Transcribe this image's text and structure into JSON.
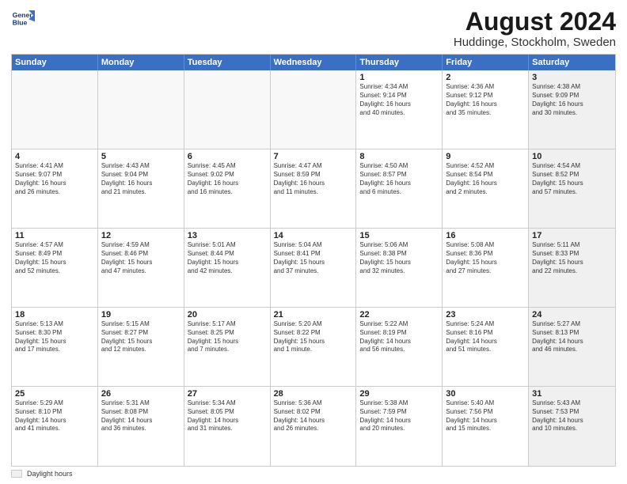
{
  "logo": {
    "line1": "General",
    "line2": "Blue"
  },
  "title": "August 2024",
  "subtitle": "Huddinge, Stockholm, Sweden",
  "weekdays": [
    "Sunday",
    "Monday",
    "Tuesday",
    "Wednesday",
    "Thursday",
    "Friday",
    "Saturday"
  ],
  "weeks": [
    [
      {
        "day": "",
        "info": "",
        "empty": true
      },
      {
        "day": "",
        "info": "",
        "empty": true
      },
      {
        "day": "",
        "info": "",
        "empty": true
      },
      {
        "day": "",
        "info": "",
        "empty": true
      },
      {
        "day": "1",
        "info": "Sunrise: 4:34 AM\nSunset: 9:14 PM\nDaylight: 16 hours\nand 40 minutes."
      },
      {
        "day": "2",
        "info": "Sunrise: 4:36 AM\nSunset: 9:12 PM\nDaylight: 16 hours\nand 35 minutes."
      },
      {
        "day": "3",
        "info": "Sunrise: 4:38 AM\nSunset: 9:09 PM\nDaylight: 16 hours\nand 30 minutes.",
        "shaded": true
      }
    ],
    [
      {
        "day": "4",
        "info": "Sunrise: 4:41 AM\nSunset: 9:07 PM\nDaylight: 16 hours\nand 26 minutes."
      },
      {
        "day": "5",
        "info": "Sunrise: 4:43 AM\nSunset: 9:04 PM\nDaylight: 16 hours\nand 21 minutes."
      },
      {
        "day": "6",
        "info": "Sunrise: 4:45 AM\nSunset: 9:02 PM\nDaylight: 16 hours\nand 16 minutes."
      },
      {
        "day": "7",
        "info": "Sunrise: 4:47 AM\nSunset: 8:59 PM\nDaylight: 16 hours\nand 11 minutes."
      },
      {
        "day": "8",
        "info": "Sunrise: 4:50 AM\nSunset: 8:57 PM\nDaylight: 16 hours\nand 6 minutes."
      },
      {
        "day": "9",
        "info": "Sunrise: 4:52 AM\nSunset: 8:54 PM\nDaylight: 16 hours\nand 2 minutes."
      },
      {
        "day": "10",
        "info": "Sunrise: 4:54 AM\nSunset: 8:52 PM\nDaylight: 15 hours\nand 57 minutes.",
        "shaded": true
      }
    ],
    [
      {
        "day": "11",
        "info": "Sunrise: 4:57 AM\nSunset: 8:49 PM\nDaylight: 15 hours\nand 52 minutes."
      },
      {
        "day": "12",
        "info": "Sunrise: 4:59 AM\nSunset: 8:46 PM\nDaylight: 15 hours\nand 47 minutes."
      },
      {
        "day": "13",
        "info": "Sunrise: 5:01 AM\nSunset: 8:44 PM\nDaylight: 15 hours\nand 42 minutes."
      },
      {
        "day": "14",
        "info": "Sunrise: 5:04 AM\nSunset: 8:41 PM\nDaylight: 15 hours\nand 37 minutes."
      },
      {
        "day": "15",
        "info": "Sunrise: 5:06 AM\nSunset: 8:38 PM\nDaylight: 15 hours\nand 32 minutes."
      },
      {
        "day": "16",
        "info": "Sunrise: 5:08 AM\nSunset: 8:36 PM\nDaylight: 15 hours\nand 27 minutes."
      },
      {
        "day": "17",
        "info": "Sunrise: 5:11 AM\nSunset: 8:33 PM\nDaylight: 15 hours\nand 22 minutes.",
        "shaded": true
      }
    ],
    [
      {
        "day": "18",
        "info": "Sunrise: 5:13 AM\nSunset: 8:30 PM\nDaylight: 15 hours\nand 17 minutes."
      },
      {
        "day": "19",
        "info": "Sunrise: 5:15 AM\nSunset: 8:27 PM\nDaylight: 15 hours\nand 12 minutes."
      },
      {
        "day": "20",
        "info": "Sunrise: 5:17 AM\nSunset: 8:25 PM\nDaylight: 15 hours\nand 7 minutes."
      },
      {
        "day": "21",
        "info": "Sunrise: 5:20 AM\nSunset: 8:22 PM\nDaylight: 15 hours\nand 1 minute."
      },
      {
        "day": "22",
        "info": "Sunrise: 5:22 AM\nSunset: 8:19 PM\nDaylight: 14 hours\nand 56 minutes."
      },
      {
        "day": "23",
        "info": "Sunrise: 5:24 AM\nSunset: 8:16 PM\nDaylight: 14 hours\nand 51 minutes."
      },
      {
        "day": "24",
        "info": "Sunrise: 5:27 AM\nSunset: 8:13 PM\nDaylight: 14 hours\nand 46 minutes.",
        "shaded": true
      }
    ],
    [
      {
        "day": "25",
        "info": "Sunrise: 5:29 AM\nSunset: 8:10 PM\nDaylight: 14 hours\nand 41 minutes."
      },
      {
        "day": "26",
        "info": "Sunrise: 5:31 AM\nSunset: 8:08 PM\nDaylight: 14 hours\nand 36 minutes."
      },
      {
        "day": "27",
        "info": "Sunrise: 5:34 AM\nSunset: 8:05 PM\nDaylight: 14 hours\nand 31 minutes."
      },
      {
        "day": "28",
        "info": "Sunrise: 5:36 AM\nSunset: 8:02 PM\nDaylight: 14 hours\nand 26 minutes."
      },
      {
        "day": "29",
        "info": "Sunrise: 5:38 AM\nSunset: 7:59 PM\nDaylight: 14 hours\nand 20 minutes."
      },
      {
        "day": "30",
        "info": "Sunrise: 5:40 AM\nSunset: 7:56 PM\nDaylight: 14 hours\nand 15 minutes."
      },
      {
        "day": "31",
        "info": "Sunrise: 5:43 AM\nSunset: 7:53 PM\nDaylight: 14 hours\nand 10 minutes.",
        "shaded": true
      }
    ]
  ],
  "legend": {
    "box_label": "Daylight hours"
  }
}
